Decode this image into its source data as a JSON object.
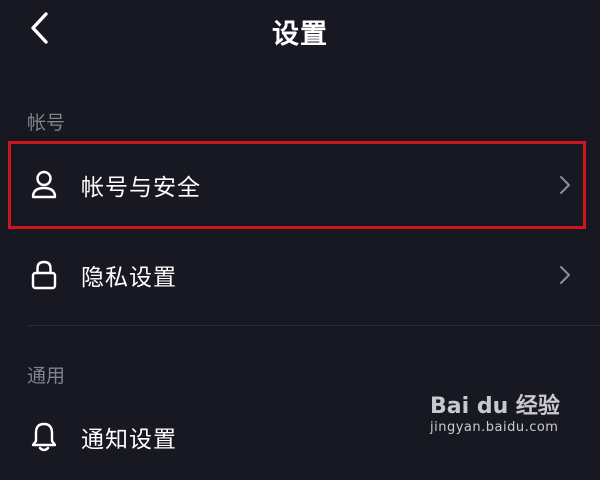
{
  "header": {
    "title": "设置"
  },
  "sections": {
    "account": {
      "label": "帐号",
      "items": [
        {
          "label": "帐号与安全",
          "icon": "user-icon"
        },
        {
          "label": "隐私设置",
          "icon": "lock-icon"
        }
      ]
    },
    "general": {
      "label": "通用",
      "items": [
        {
          "label": "通知设置",
          "icon": "bell-icon"
        }
      ]
    }
  },
  "highlight": {
    "color": "#d0141e"
  },
  "theme": {
    "background": "#171821",
    "section_label_color": "#80828c",
    "text_color": "#ffffff"
  },
  "watermark": {
    "logo_text": "Bai du 经验",
    "url": "jingyan.baidu.com"
  }
}
